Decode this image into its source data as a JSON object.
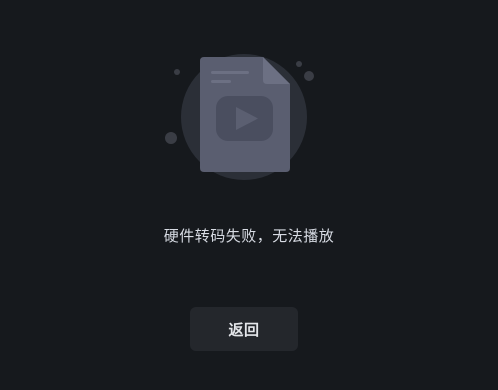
{
  "illustration": {
    "icon": "video-file-error-icon",
    "colors": {
      "halo": "#2b2f37",
      "document": "#5a5e70",
      "document_fold": "#6c7083",
      "play_badge": "#4a4e5f",
      "play_triangle": "#5b5f71",
      "dots": "#3a3d45"
    }
  },
  "message": {
    "text": "硬件转码失败，无法播放"
  },
  "actions": {
    "back_label": "返回"
  },
  "colors": {
    "background": "#16191d",
    "button_background": "#24272c",
    "text": "#d7dbe3"
  }
}
